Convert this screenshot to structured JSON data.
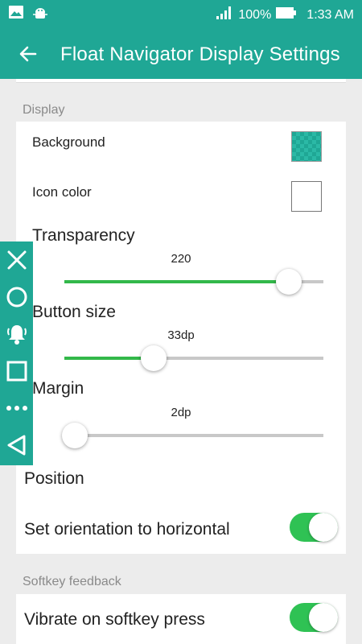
{
  "status_bar": {
    "battery_percent": "100%",
    "time": "1:33 AM",
    "icons": [
      "image-notification-icon",
      "android-debug-icon",
      "signal-icon",
      "battery-icon"
    ]
  },
  "app_bar": {
    "title": "Float Navigator Display Settings",
    "back_icon": "back-arrow-icon"
  },
  "display_section": {
    "title": "Display",
    "background_label": "Background",
    "icon_color_label": "Icon color",
    "transparency": {
      "label": "Transparency",
      "value": "220",
      "fraction": 0.865
    },
    "button_size": {
      "label": "Button size",
      "value": "33dp",
      "fraction": 0.345
    },
    "margin": {
      "label": "Margin",
      "value": "2dp",
      "fraction": 0.04
    },
    "position_label": "Position",
    "orientation": {
      "label": "Set orientation to horizontal",
      "enabled": true
    }
  },
  "softkey_section": {
    "title": "Softkey feedback",
    "vibrate": {
      "label": "Vibrate on softkey press",
      "enabled": true
    }
  },
  "float_navigator": {
    "buttons": [
      "close-icon",
      "circle-home-icon",
      "notification-bell-icon",
      "square-recents-icon",
      "more-dots-icon",
      "triangle-back-icon"
    ]
  },
  "colors": {
    "accent": "#1fa795",
    "toggle_on": "#2fc254",
    "slider_fill": "#33b84a"
  }
}
